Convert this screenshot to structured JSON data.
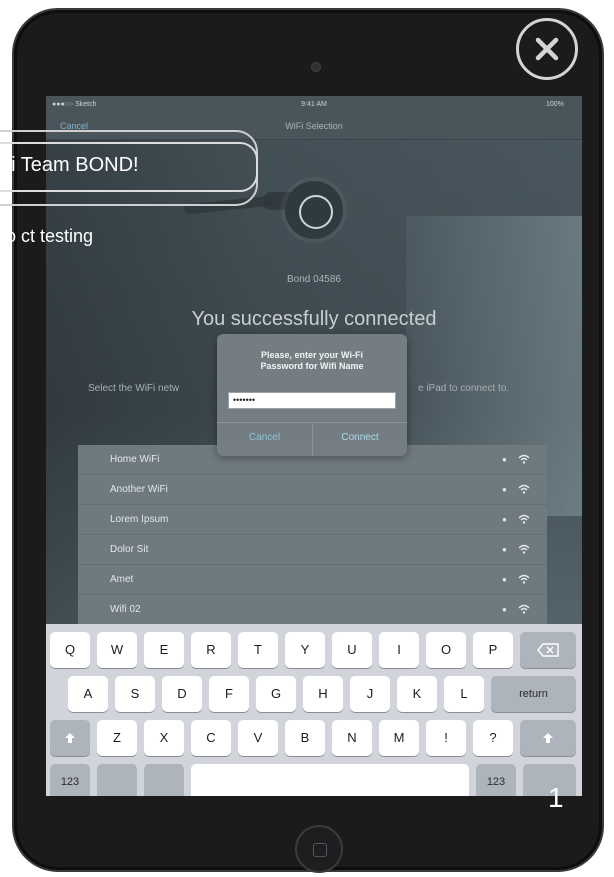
{
  "callout": {
    "title": "oi Team BOND!",
    "subtitle": "ro ct testing"
  },
  "status_bar": {
    "carrier": "●●●○○ Sketch",
    "time": "9:41 AM",
    "battery": "100%"
  },
  "nav": {
    "cancel": "Cancel",
    "title": "WiFi Selection"
  },
  "device": {
    "name": "Bond 04586"
  },
  "headline": "You successfully connected",
  "instruction_left": "Select the WiFi netw",
  "instruction_right": "e iPad to connect to.",
  "alert": {
    "message_line1": "Please, enter your Wi-Fi",
    "message_line2": "Password for Wifi Name",
    "password_value": "•••••••",
    "cancel": "Cancel",
    "connect": "Connect"
  },
  "wifi_networks": [
    {
      "name": "Home WiFi"
    },
    {
      "name": "Another WiFi"
    },
    {
      "name": "Lorem Ipsum"
    },
    {
      "name": "Dolor Sit"
    },
    {
      "name": "Amet"
    },
    {
      "name": "Wifi 02"
    }
  ],
  "keyboard": {
    "row1": [
      "Q",
      "W",
      "E",
      "R",
      "T",
      "Y",
      "U",
      "I",
      "O",
      "P"
    ],
    "row2": [
      "A",
      "S",
      "D",
      "F",
      "G",
      "H",
      "J",
      "K",
      "L"
    ],
    "row3": [
      "Z",
      "X",
      "C",
      "V",
      "B",
      "N",
      "M",
      "!",
      "?"
    ],
    "return_label": "return",
    "numbers_label": "123"
  },
  "page_number": "1",
  "icons": {
    "close": "close-icon",
    "wifi": "wifi-icon",
    "lock": "lock-icon",
    "shift": "shift-icon",
    "backspace": "backspace-icon"
  },
  "colors": {
    "link": "#8fc4d8",
    "keyboard_bg": "#d1d5db"
  }
}
